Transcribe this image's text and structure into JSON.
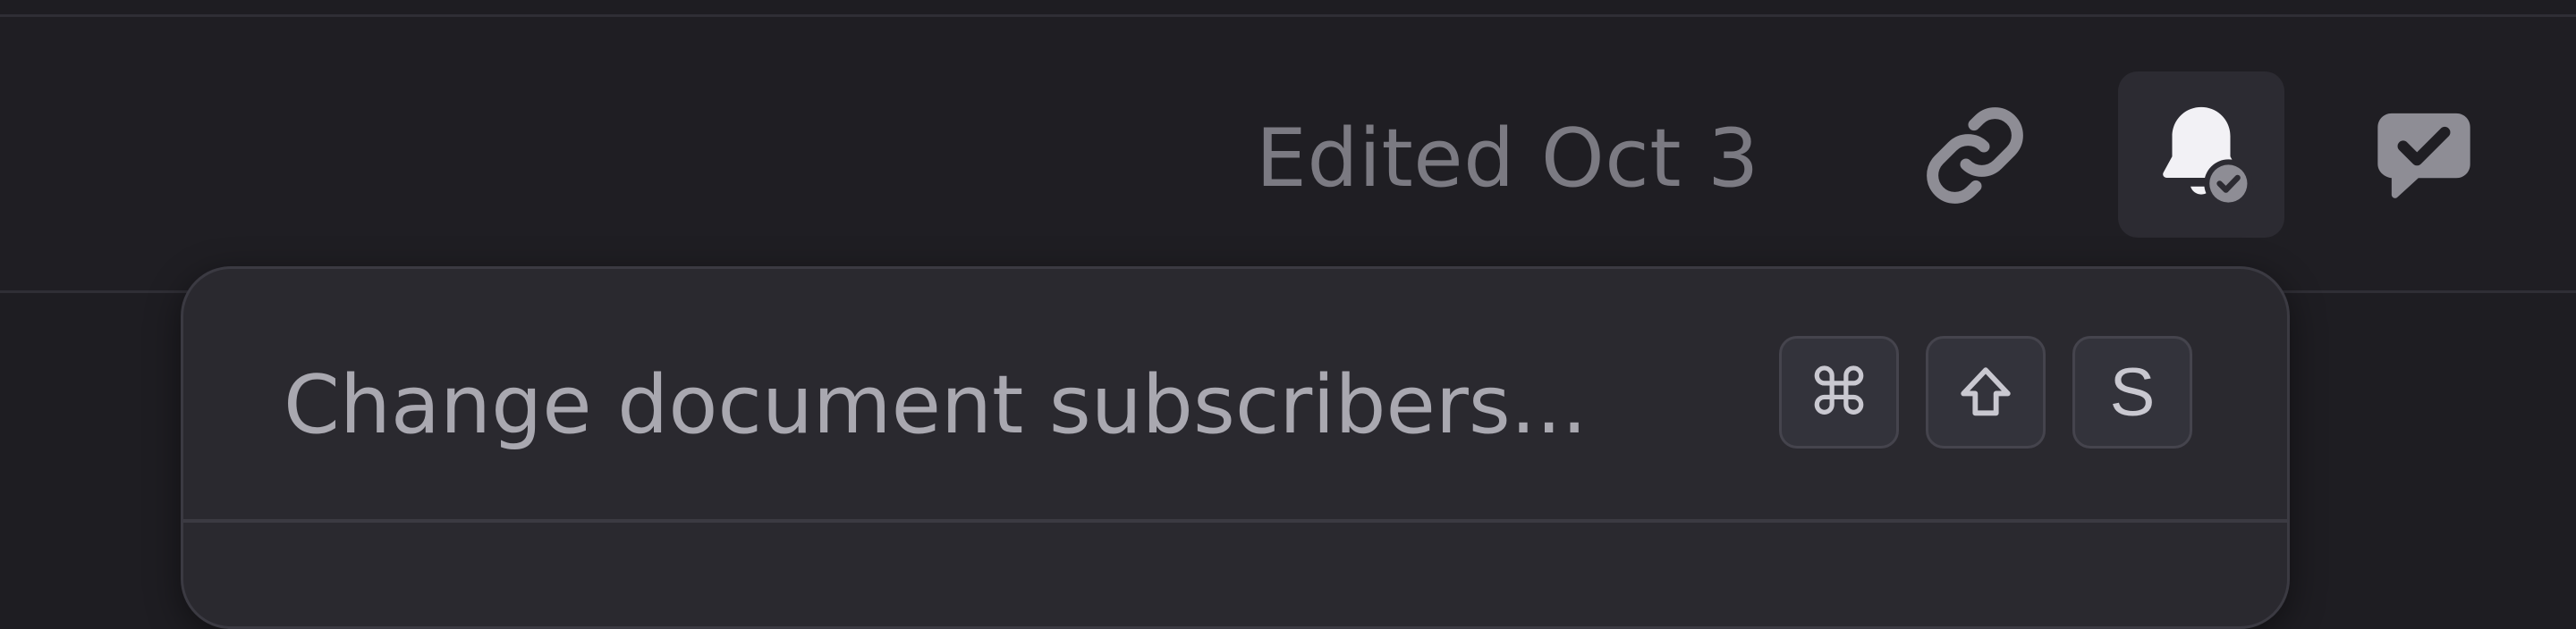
{
  "toolbar": {
    "edited_label": "Edited Oct 3",
    "icons": {
      "link": "link-icon",
      "subscribed_bell": "bell-check-icon",
      "comment": "comment-check-icon"
    }
  },
  "tooltip": {
    "label": "Change document subscribers...",
    "shortcut_keys": [
      "⌘",
      "⇧",
      "S"
    ]
  },
  "colors": {
    "background": "#1f1e23",
    "popover": "#2a292f",
    "muted_text": "#7b7a82",
    "icon": "#8e8d95"
  }
}
